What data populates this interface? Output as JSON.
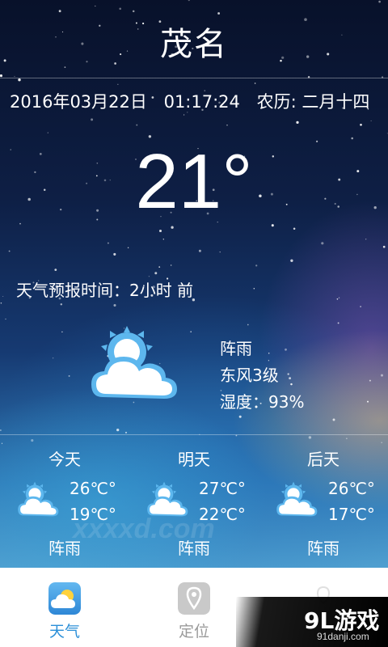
{
  "city": "茂名",
  "date": "2016年03月22日",
  "time": "01:17:24",
  "lunar": "农历: 二月十四",
  "current": {
    "temperature": "21°",
    "updated": "天气预报时间：2小时 前",
    "condition": "阵雨",
    "wind": "东风3级",
    "humidity": "湿度：93%",
    "icon": "partly-cloudy-icon"
  },
  "forecast": [
    {
      "day": "今天",
      "high": "26℃°",
      "low": "19℃°",
      "condition": "阵雨",
      "icon": "partly-cloudy-icon"
    },
    {
      "day": "明天",
      "high": "27℃°",
      "low": "22℃°",
      "condition": "阵雨",
      "icon": "partly-cloudy-icon"
    },
    {
      "day": "后天",
      "high": "26℃°",
      "low": "17℃°",
      "condition": "阵雨",
      "icon": "partly-cloudy-icon"
    }
  ],
  "tabs": [
    {
      "label": "天气",
      "icon": "weather-icon",
      "active": true
    },
    {
      "label": "定位",
      "icon": "location-icon",
      "active": false
    },
    {
      "label": "",
      "icon": "settings-icon",
      "active": false
    }
  ],
  "watermark": {
    "text": "xxxxd.com",
    "logo": "9L游戏",
    "url": "91danji.com"
  },
  "colors": {
    "accent": "#2b8fd8",
    "icon_sun": "#5db7ee",
    "tab_inactive": "#9a9a9a"
  }
}
